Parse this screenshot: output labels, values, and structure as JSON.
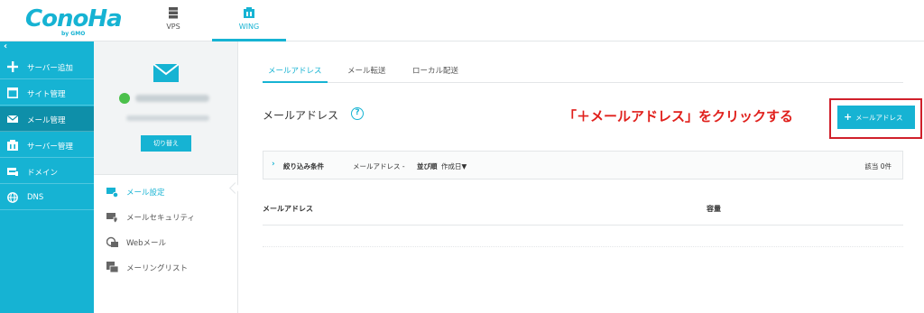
{
  "brand": {
    "logo_text": "ConoHa",
    "logo_sub": "by GMO",
    "color": "#16b3d3"
  },
  "top_tabs": [
    {
      "label": "VPS",
      "icon": "server-icon",
      "active": false
    },
    {
      "label": "WING",
      "icon": "wing-icon",
      "active": true
    }
  ],
  "sidebar": {
    "collapse_icon": "chevron-left-icon",
    "items": [
      {
        "label": "サーバー追加",
        "icon": "plus-icon",
        "active": false
      },
      {
        "label": "サイト管理",
        "icon": "window-icon",
        "active": false
      },
      {
        "label": "メール管理",
        "icon": "envelope-icon",
        "active": true
      },
      {
        "label": "サーバー管理",
        "icon": "server-stack-icon",
        "active": false
      },
      {
        "label": "ドメイン",
        "icon": "domain-icon",
        "active": false
      },
      {
        "label": "DNS",
        "icon": "globe-icon",
        "active": false
      }
    ]
  },
  "account": {
    "switch_label": "切り替え",
    "status_color": "#4bc04b"
  },
  "subnav": {
    "items": [
      {
        "label": "メール設定",
        "icon": "mail-gear-icon",
        "active": true
      },
      {
        "label": "メールセキュリティ",
        "icon": "mail-shield-icon",
        "active": false
      },
      {
        "label": "Webメール",
        "icon": "webmail-icon",
        "active": false
      },
      {
        "label": "メーリングリスト",
        "icon": "mailing-list-icon",
        "active": false
      }
    ]
  },
  "main": {
    "tabs": [
      {
        "label": "メールアドレス",
        "active": true
      },
      {
        "label": "メール転送",
        "active": false
      },
      {
        "label": "ローカル配送",
        "active": false
      }
    ],
    "title": "メールアドレス",
    "help_glyph": "?",
    "annotation": "「＋メールアドレス」をクリックする",
    "annotation_color": "#e0201c",
    "add_button": {
      "plus": "+",
      "label": "メールアドレス"
    },
    "filter": {
      "label": "絞り込み条件",
      "field": "メールアドレス  -",
      "sort_label": "並び順",
      "sort_value": "作成日▼",
      "count": "該当 0件"
    },
    "table": {
      "columns": [
        "メールアドレス",
        "容量"
      ]
    }
  }
}
